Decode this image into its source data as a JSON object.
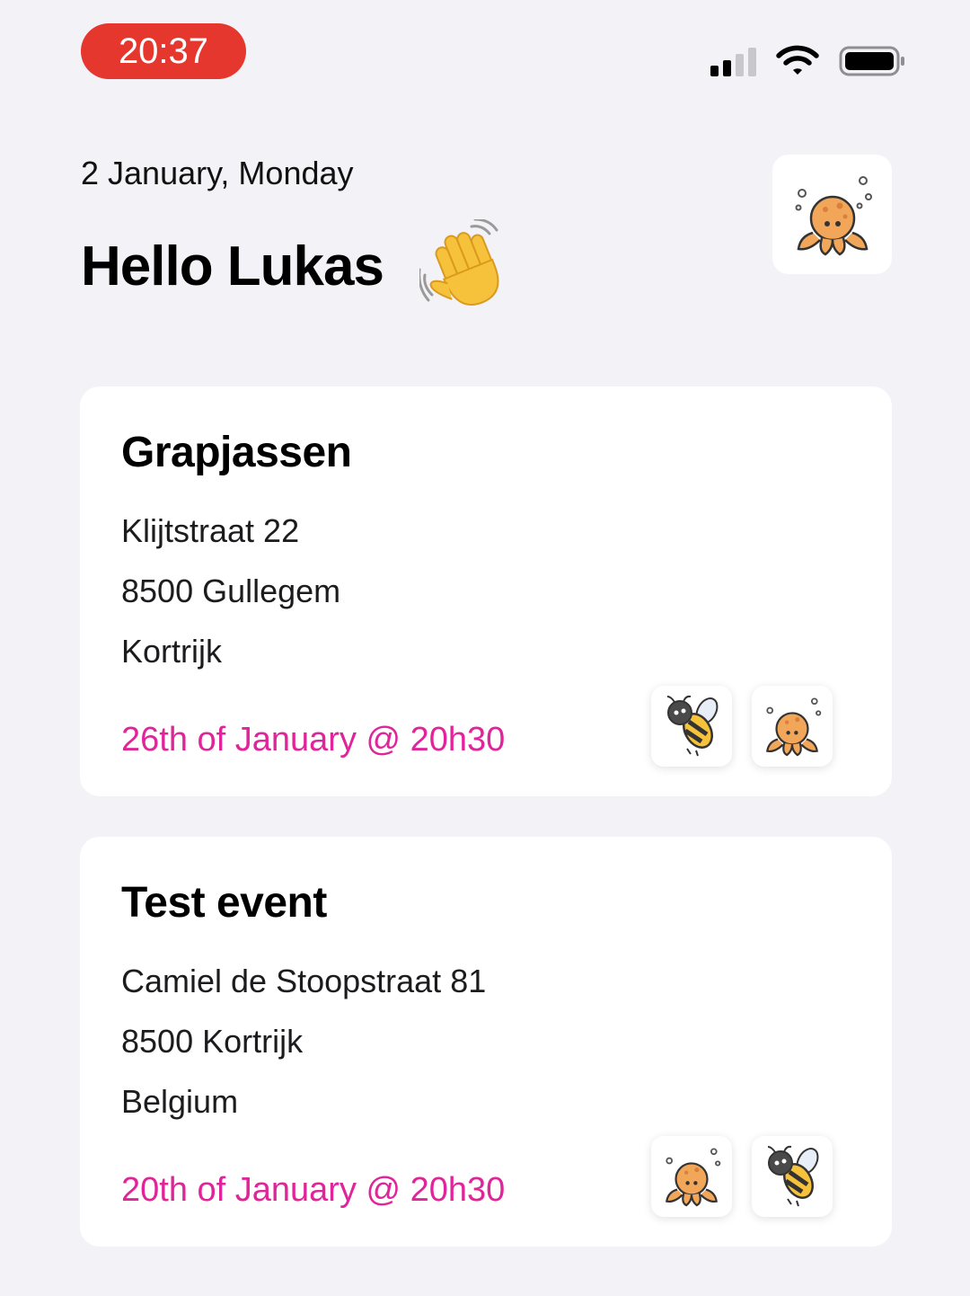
{
  "status_bar": {
    "time": "20:37",
    "icons": [
      "cellular-signal-icon",
      "wifi-icon",
      "battery-icon"
    ]
  },
  "header": {
    "date": "2 January, Monday",
    "greeting": "Hello Lukas",
    "wave_icon": "waving-hand-icon",
    "profile_icon": "octopus-avatar-icon"
  },
  "events": [
    {
      "title": "Grapjassen",
      "address_line1": "Klijtstraat 22",
      "address_line2": "8500 Gullegem",
      "address_line3": "Kortrijk",
      "datetime": "26th of January @ 20h30",
      "attendees": [
        "bee-avatar-icon",
        "octopus-avatar-icon"
      ]
    },
    {
      "title": "Test event",
      "address_line1": "Camiel de Stoopstraat 81",
      "address_line2": "8500 Kortrijk",
      "address_line3": "Belgium",
      "datetime": "20th of January @ 20h30",
      "attendees": [
        "octopus-avatar-icon",
        "bee-avatar-icon"
      ]
    }
  ],
  "colors": {
    "background": "#f3f2f7",
    "card": "#ffffff",
    "date_accent": "#e0249a",
    "time_pill": "#e5372e"
  }
}
